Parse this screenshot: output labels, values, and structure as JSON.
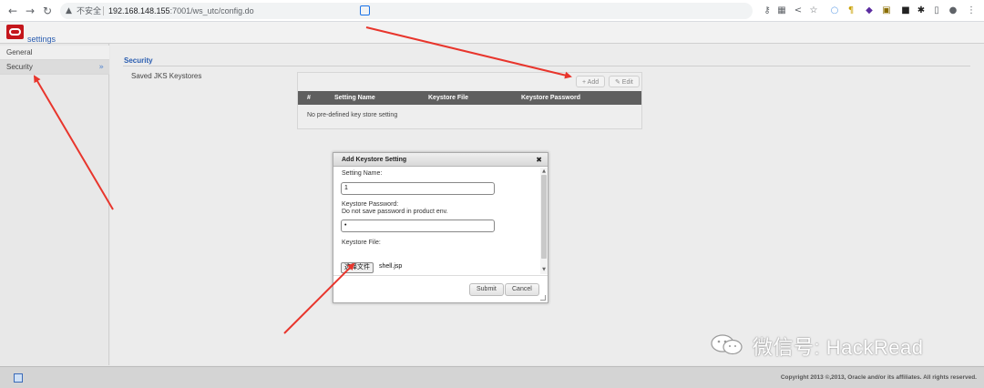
{
  "browser": {
    "warning_icon": "▲",
    "insecure_label": "不安全",
    "url_host": "192.168.148.155",
    "url_rest": ":7001/ws_utc/config.do",
    "icons": [
      "key-icon",
      "translate-icon",
      "share-icon",
      "star-icon",
      "extension-icon",
      "profile-icon",
      "menu-icon"
    ]
  },
  "app": {
    "title": "settings",
    "brand_color": "#c4161c"
  },
  "sidebar": {
    "items": [
      {
        "label": "General"
      },
      {
        "label": "Security",
        "chevron": "»"
      }
    ]
  },
  "main": {
    "section_title": "Security",
    "saved_label": "Saved JKS Keystores",
    "grid": {
      "add_label": "+ Add",
      "edit_label": "✎ Edit",
      "columns": [
        "#",
        "Setting Name",
        "Keystore File",
        "Keystore Password"
      ],
      "empty_text": "No pre-defined key store setting"
    }
  },
  "dialog": {
    "title": "Add Keystore Setting",
    "close": "✖",
    "setting_name_label": "Setting Name:",
    "setting_name_value": "1",
    "password_label": "Keystore Password:",
    "password_hint": "Do not save password in product env.",
    "password_value": "•",
    "file_label": "Keystore File:",
    "file_button": "选择文件",
    "file_name": "shell.jsp",
    "submit_label": "Submit",
    "cancel_label": "Cancel"
  },
  "watermark": {
    "text": "微信号: HackRead"
  },
  "footer": {
    "copyright": "Copyright 2013 ©,2013, Oracle and/or its affiliates. All rights reserved."
  },
  "colors": {
    "arrow": "#e8352c",
    "link_blue": "#2a5db0",
    "grid_header": "#5f5f5f"
  }
}
